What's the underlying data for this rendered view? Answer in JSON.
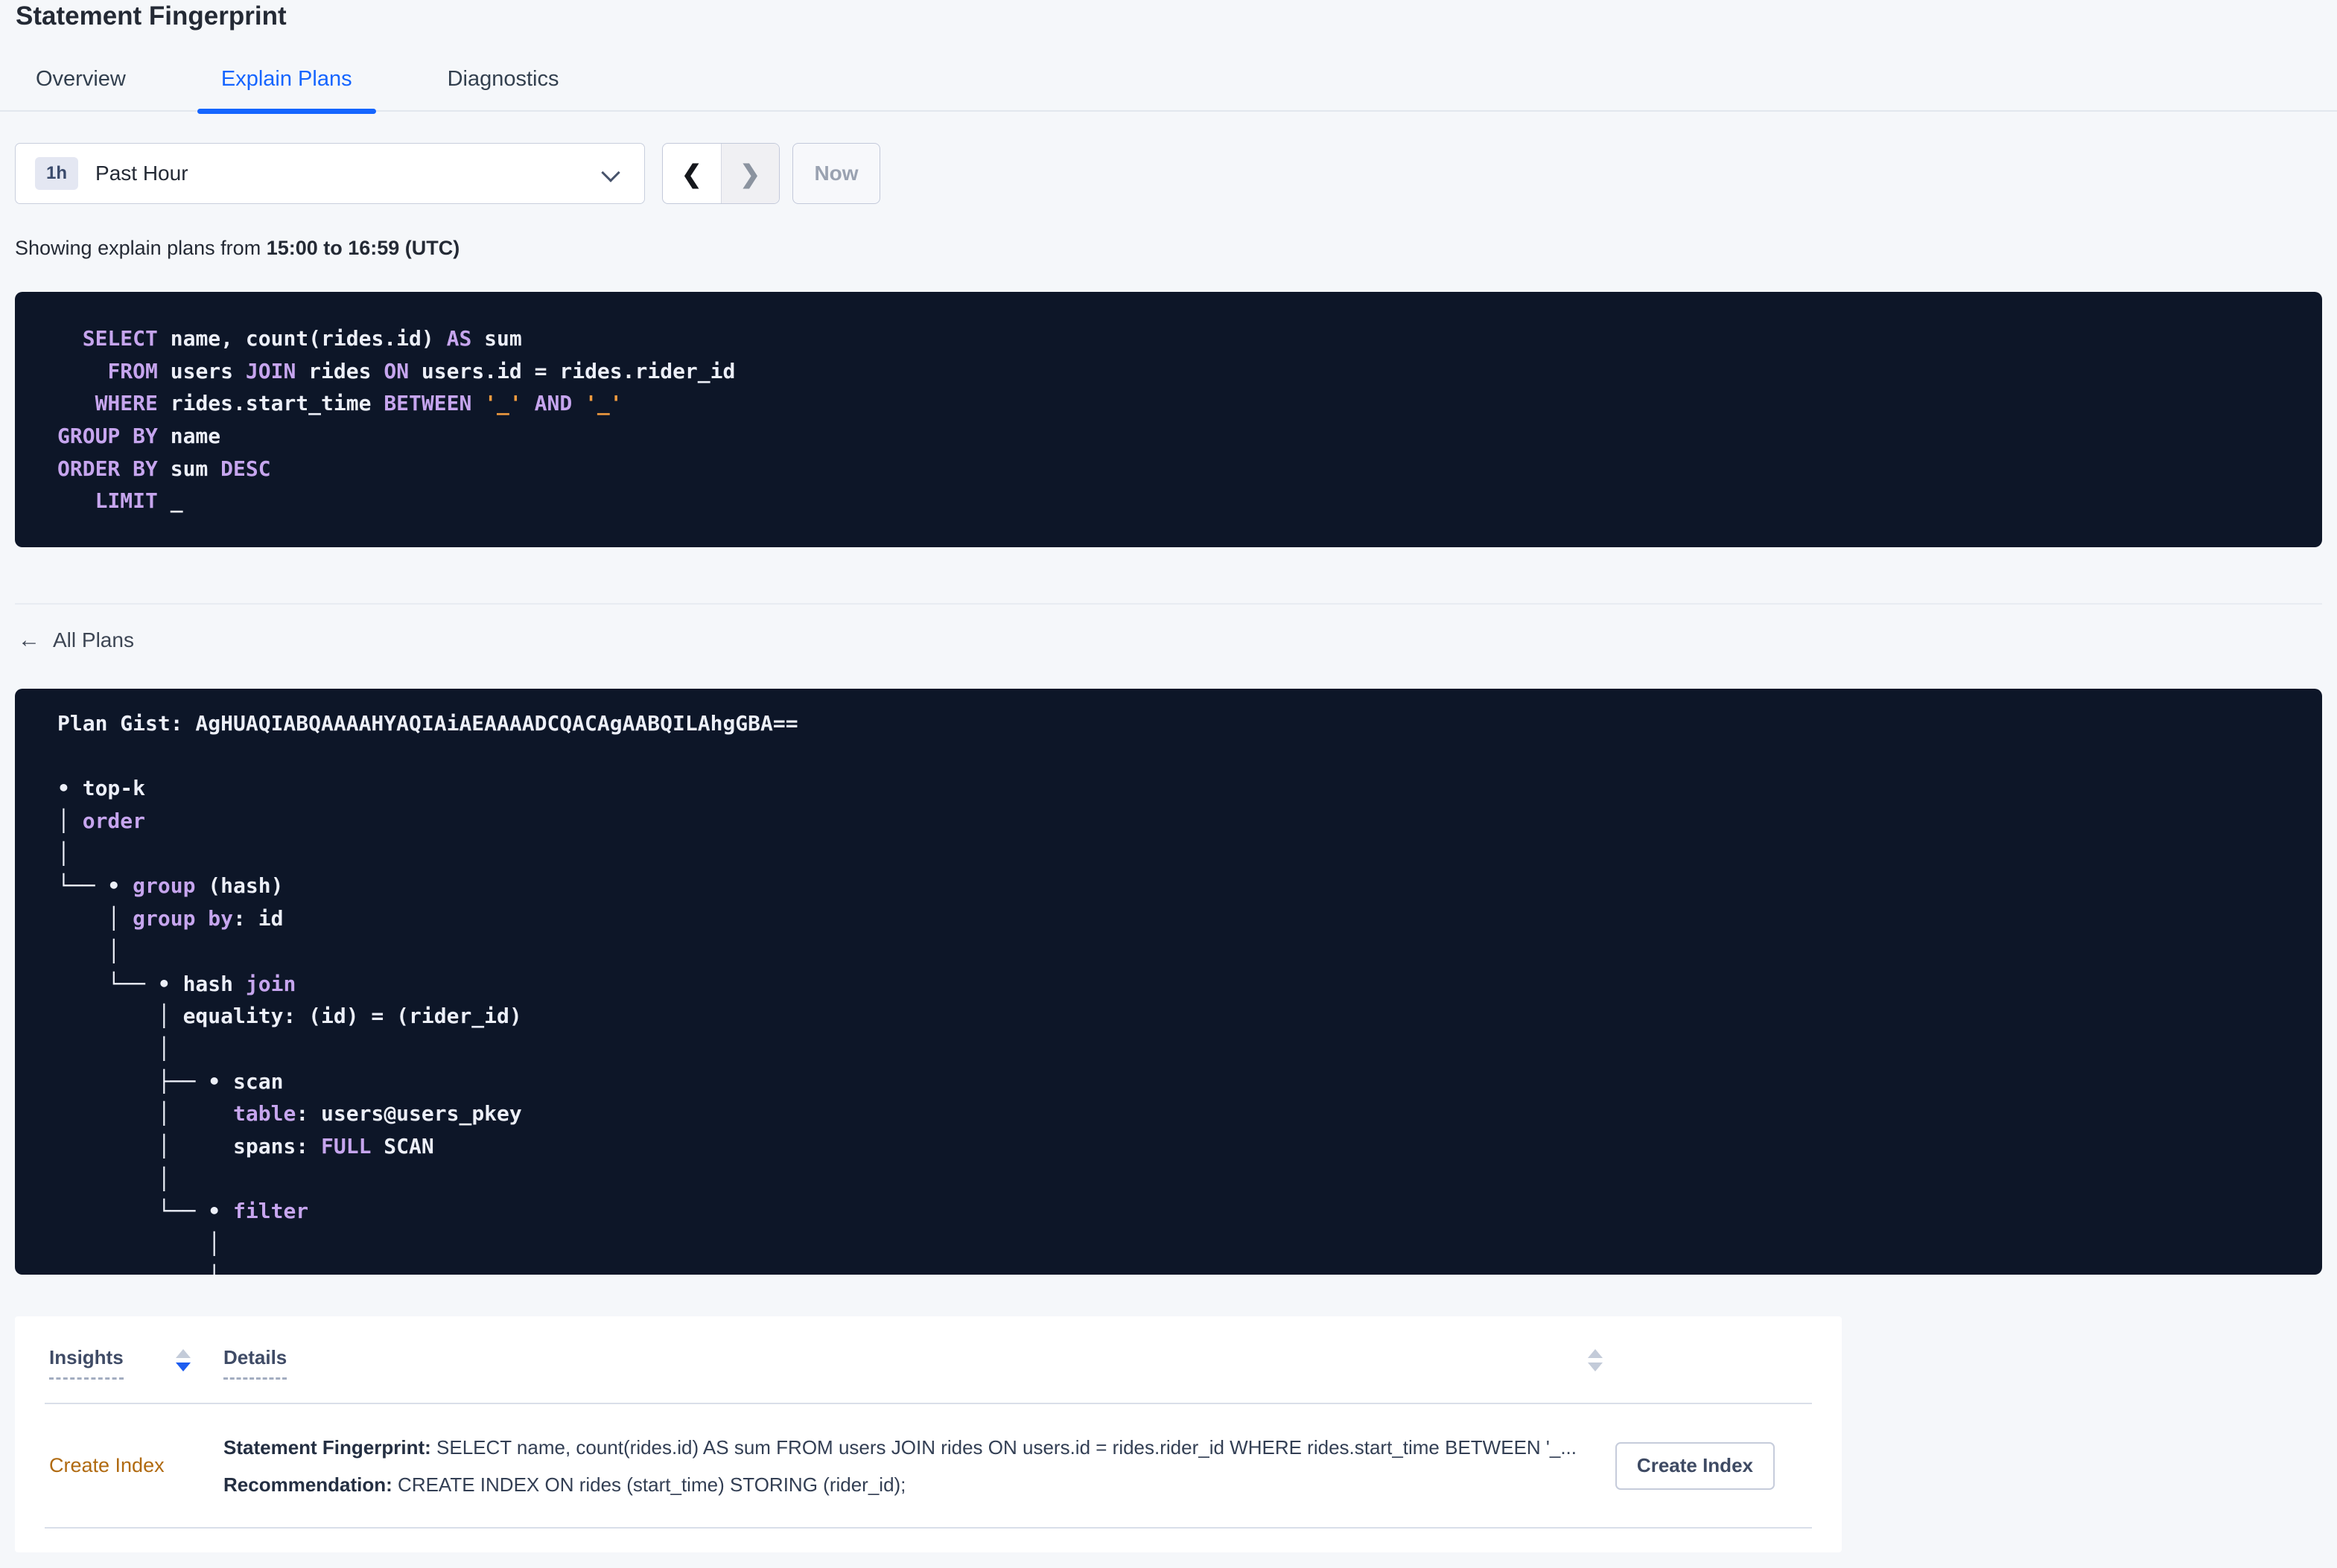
{
  "page_title": "Statement Fingerprint",
  "tabs": {
    "overview": "Overview",
    "explain_plans": "Explain Plans",
    "diagnostics": "Diagnostics"
  },
  "time_controls": {
    "interval_badge": "1h",
    "interval_label": "Past Hour",
    "prev_icon": "❮",
    "next_icon": "❯",
    "now_label": "Now"
  },
  "summary": {
    "prefix": "Showing explain plans from ",
    "range_bold": "15:00 to 16:59 (UTC)"
  },
  "sql_box": {
    "lines": [
      [
        [
          "id",
          "  "
        ],
        [
          "kw",
          "SELECT"
        ],
        [
          "id",
          " name, count(rides.id) "
        ],
        [
          "kw",
          "AS"
        ],
        [
          "id",
          " sum"
        ]
      ],
      [
        [
          "id",
          "    "
        ],
        [
          "kw",
          "FROM"
        ],
        [
          "id",
          " users "
        ],
        [
          "kw",
          "JOIN"
        ],
        [
          "id",
          " rides "
        ],
        [
          "kw",
          "ON"
        ],
        [
          "id",
          " users.id = rides.rider_id"
        ]
      ],
      [
        [
          "id",
          "   "
        ],
        [
          "kw",
          "WHERE"
        ],
        [
          "id",
          " rides.start_time "
        ],
        [
          "kw",
          "BETWEEN"
        ],
        [
          "id",
          " "
        ],
        [
          "lit",
          "'_'"
        ],
        [
          "id",
          " "
        ],
        [
          "kw",
          "AND"
        ],
        [
          "id",
          " "
        ],
        [
          "lit",
          "'_'"
        ]
      ],
      [
        [
          "kw",
          "GROUP BY"
        ],
        [
          "id",
          " name"
        ]
      ],
      [
        [
          "kw",
          "ORDER BY"
        ],
        [
          "id",
          " sum "
        ],
        [
          "kw",
          "DESC"
        ]
      ],
      [
        [
          "id",
          "   "
        ],
        [
          "kw",
          "LIMIT"
        ],
        [
          "id",
          " _"
        ]
      ]
    ]
  },
  "all_plans_link": {
    "arrow_icon": "←",
    "label": "All Plans"
  },
  "plan_box": {
    "gist": "Plan Gist: AgHUAQIABQAAAAHYAQIAiAEAAAADCQACAgAABQILAhgGBA==",
    "lines": [
      [
        [
          "id",
          "Plan Gist: AgHUAQIABQAAAAHYAQIAiAEAAAADCQACAgAABQILAhgGBA=="
        ]
      ],
      [],
      [
        [
          "id",
          "• top-k"
        ]
      ],
      [
        [
          "id",
          "│ "
        ],
        [
          "kw",
          "order"
        ]
      ],
      [
        [
          "id",
          "│"
        ]
      ],
      [
        [
          "id",
          "└── • "
        ],
        [
          "kw",
          "group"
        ],
        [
          "id",
          " (hash)"
        ]
      ],
      [
        [
          "id",
          "    │ "
        ],
        [
          "kw",
          "group by"
        ],
        [
          "id",
          ": id"
        ]
      ],
      [
        [
          "id",
          "    │"
        ]
      ],
      [
        [
          "id",
          "    └── • hash "
        ],
        [
          "kw",
          "join"
        ]
      ],
      [
        [
          "id",
          "        │ equality: (id) = (rider_id)"
        ]
      ],
      [
        [
          "id",
          "        │"
        ]
      ],
      [
        [
          "id",
          "        ├── • scan"
        ]
      ],
      [
        [
          "id",
          "        │     "
        ],
        [
          "kw",
          "table"
        ],
        [
          "id",
          ": users@users_pkey"
        ]
      ],
      [
        [
          "id",
          "        │     spans: "
        ],
        [
          "kw",
          "FULL"
        ],
        [
          "id",
          " SCAN"
        ]
      ],
      [
        [
          "id",
          "        │"
        ]
      ],
      [
        [
          "id",
          "        └── • "
        ],
        [
          "kw",
          "filter"
        ]
      ],
      [
        [
          "id",
          "            │"
        ]
      ],
      [
        [
          "id",
          "            │"
        ]
      ]
    ]
  },
  "insights_table": {
    "headers": {
      "insights": "Insights",
      "details": "Details"
    },
    "row": {
      "insight_link": "Create Index",
      "fingerprint_label": "Statement Fingerprint:",
      "fingerprint_text": " SELECT name, count(rides.id) AS sum FROM users JOIN rides ON users.id = rides.rider_id WHERE rides.start_time BETWEEN '_...",
      "recommendation_label": "Recommendation:",
      "recommendation_text": " CREATE INDEX ON rides (start_time) STORING (rider_id);",
      "action_button": "Create Index"
    }
  },
  "colors": {
    "page_bg": "#f5f7fa",
    "accent_blue": "#1565ff",
    "code_bg": "#0d1628",
    "code_text": "#eceff8",
    "code_keyword": "#c6a5ee",
    "code_literal": "#f19b3f",
    "insight_link_orange": "#b06a10"
  }
}
